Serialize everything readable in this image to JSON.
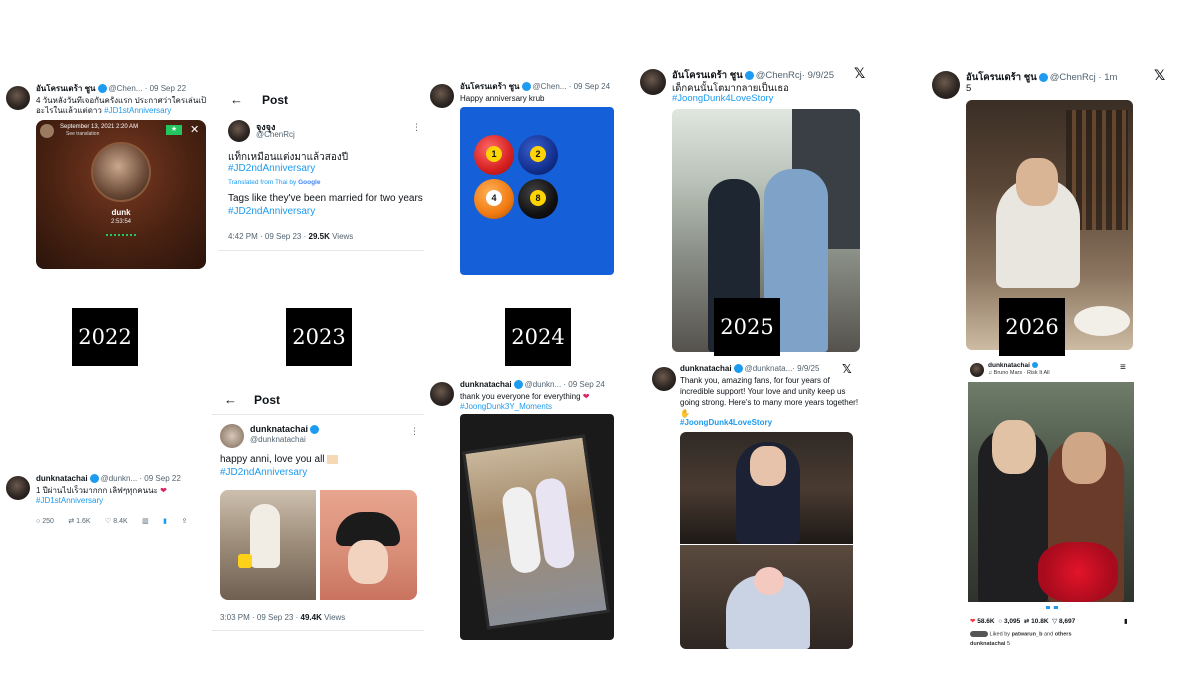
{
  "years": [
    "2022",
    "2023",
    "2024",
    "2025",
    "2026"
  ],
  "col2022": {
    "top": {
      "name": "อันโครนเดร้า ชูน",
      "handle": "@Chen...",
      "date": "· 09 Sep 22",
      "line1": "4 วันหลังวันที่เจอกันครั้งแรก ประกาศว่าใครเล่นเป็น",
      "line2": "อะไรในแล้วแต่ดาว",
      "hashtag": "#JD1stAnniversary",
      "call": {
        "date": "September 13, 2021",
        "time": "2:20 AM",
        "see": "See translation",
        "name": "dunk",
        "duration": "2:53:54"
      }
    },
    "bottom": {
      "name": "dunknatachai",
      "handle": "@dunkn...",
      "date": "· 09 Sep 22",
      "line1": "1 ปีผ่านไปเร็วมากกก เลิฟๆทุกคนนะ",
      "hashtag": "#JD1stAnniversary",
      "replies": "250",
      "retweets": "1.6K",
      "likes": "8.4K"
    }
  },
  "col2023": {
    "top": {
      "header": "Post",
      "name": "จุงจุง",
      "handle": "@ChenRcj",
      "line1": "แท็กเหมือนแต่งมาแล้วสองปี",
      "hashtag": "#JD2ndAnniversary",
      "translated": "Translated from Thai by",
      "google": "Google",
      "trans_line": "Tags like they've been married for two years",
      "trans_tag": "#JD2ndAnniversary",
      "time": "4:42 PM · 09 Sep 23 ·",
      "views": "29.5K",
      "views_label": "Views"
    },
    "bottom": {
      "header": "Post",
      "name": "dunknatachai",
      "handle": "@dunknatachai",
      "line1": "happy anni, love you all",
      "hashtag": "#JD2ndAnniversary",
      "time": "3:03 PM · 09 Sep 23 ·",
      "views": "49.4K",
      "views_label": "Views"
    }
  },
  "col2024": {
    "top": {
      "name": "อันโครนเดร้า ชูน",
      "handle": "@Chen...",
      "date": "· 09 Sep 24",
      "line1": "Happy anniversary krub",
      "balls": [
        "1",
        "2",
        "4",
        "8"
      ]
    },
    "bottom": {
      "name": "dunknatachai",
      "handle": "@dunkn...",
      "date": "· 09 Sep 24",
      "line1": "thank you everyone for everything",
      "hashtag": "#JoongDunk3Y_Moments"
    }
  },
  "col2025": {
    "top": {
      "name": "อันโครนเดร้า ชูน",
      "handle": "@ChenRcj",
      "date": "· 9/9/25",
      "line1": "เด็กคนนั้นโตมากลายเป็นเธอ",
      "hashtag": "#JoongDunk4LoveStory"
    },
    "bottom": {
      "name": "dunknatachai",
      "handle": "@dunknata...",
      "date": "· 9/9/25",
      "line1": "Thank you, amazing fans, for four years of incredible support! Your love and unity keep us going strong. Here's to many more years together!",
      "hashtag": "#JoongDunk4LoveStory"
    }
  },
  "col2026": {
    "top": {
      "name": "อันโครนเดร้า ชูน",
      "handle": "@ChenRcj",
      "date": "· 1m",
      "line1": "5"
    },
    "bottom": {
      "name": "dunknatachai",
      "song": "Bruno Mars · Risk It All",
      "likes": "58.6K",
      "comments": "3,095",
      "reposts": "10.8K",
      "shares": "8,697",
      "liked_by": "Liked by",
      "liked_user": "patwarun_b",
      "and": "and",
      "others": "others",
      "caption_user": "dunknatachai",
      "caption": "5"
    }
  },
  "colors": {
    "link": "#1d9bf0",
    "like": "#f91880",
    "year_bg": "#000000"
  }
}
